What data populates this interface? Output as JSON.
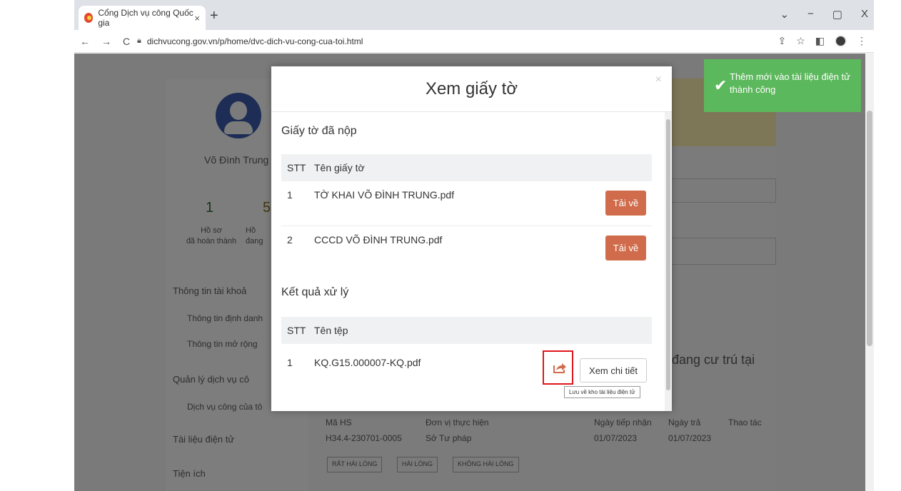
{
  "browser": {
    "tab_title": "Cổng Dịch vụ công Quốc gia",
    "tab_close": "×",
    "new_tab": "+",
    "url": "dichvucong.gov.vn/p/home/dvc-dich-vu-cong-cua-toi.html",
    "nav": {
      "back": "←",
      "forward": "→",
      "reload": "C"
    },
    "window": {
      "chevron": "⌄",
      "minimize": "−",
      "restore": "▢",
      "close": "X"
    },
    "toolbar_icons": {
      "share": "⇪",
      "bookmark": "☆",
      "sidepanel": "◧",
      "menu": "⋮"
    }
  },
  "page": {
    "username": "Võ Đình Trung",
    "stat_completed_value": "1",
    "stat_completed_label_1": "Hồ sơ",
    "stat_completed_label_2": "đã hoàn thành",
    "stat_processing_value": "5",
    "stat_processing_label_1": "Hồ",
    "stat_processing_label_2": "đang",
    "sidebar": {
      "account": "Thông tin tài khoả",
      "identity": "Thông tin định danh",
      "extended": "Thông tin mở rộng",
      "services": "Quản lý dịch vụ cô",
      "my_services": "Dịch vụ công của tô",
      "documents": "Tài liệu điện tử",
      "utilities": "Tiện ích"
    },
    "residence_text": "i đang cư trú tại",
    "record": {
      "h_code": "Mã HS",
      "h_unit": "Đơn vị thực hiện",
      "h_received": "Ngày tiếp nhận",
      "h_return": "Ngày trả",
      "h_action": "Thao tác",
      "code": "H34.4-230701-0005",
      "unit": "Sở Tư pháp",
      "received": "01/07/2023",
      "return": "01/07/2023"
    },
    "feedback": [
      "RẤT HÀI LÒNG",
      "HÀI LÒNG",
      "KHÔNG HÀI LÒNG"
    ]
  },
  "modal": {
    "title": "Xem giấy tờ",
    "close": "×",
    "submitted_title": "Giấy tờ đã nộp",
    "submitted_headers": {
      "stt": "STT",
      "name": "Tên giấy tờ"
    },
    "submitted_rows": [
      {
        "stt": "1",
        "name": "TỜ KHAI VÕ ĐÌNH TRUNG.pdf",
        "action": "Tải về"
      },
      {
        "stt": "2",
        "name": "CCCD VÕ ĐÌNH TRUNG.pdf",
        "action": "Tải về"
      }
    ],
    "result_title": "Kết quả xử lý",
    "result_headers": {
      "stt": "STT",
      "name": "Tên tệp"
    },
    "result_rows": [
      {
        "stt": "1",
        "name": "KQ.G15.000007-KQ.pdf",
        "detail": "Xem chi tiết"
      }
    ],
    "save_tooltip": "Lưu về kho tài liệu điện tử"
  },
  "toast": {
    "check": "✔",
    "message": "Thêm mới vào tài liệu điện tử thành công"
  },
  "colors": {
    "download": "#d06c4b",
    "toast": "#5cb85c",
    "highlight": "#e0161b"
  }
}
